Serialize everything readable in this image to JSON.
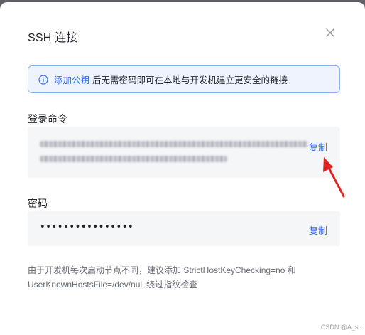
{
  "dialog": {
    "title": "SSH 连接",
    "close_icon": "close-icon"
  },
  "info": {
    "icon": "info-circle-icon",
    "link": "添加公钥",
    "text": "后无需密码即可在本地与开发机建立更安全的链接"
  },
  "command": {
    "label": "登录命令",
    "copy": "复制"
  },
  "password": {
    "label": "密码",
    "value": "••••••••••••••••",
    "copy": "复制"
  },
  "note": {
    "line1": "由于开发机每次启动节点不同，建议添加 StrictHostKeyChecking=no 和",
    "line2": "UserKnownHostsFile=/dev/null 绕过指纹检查"
  },
  "watermark": "CSDN @A_sc",
  "colors": {
    "accent": "#3370ff",
    "info_bg": "#eef3fd",
    "info_border": "#8fb1f2",
    "field_bg": "#f5f6f7",
    "annotation_arrow": "#e02424"
  }
}
